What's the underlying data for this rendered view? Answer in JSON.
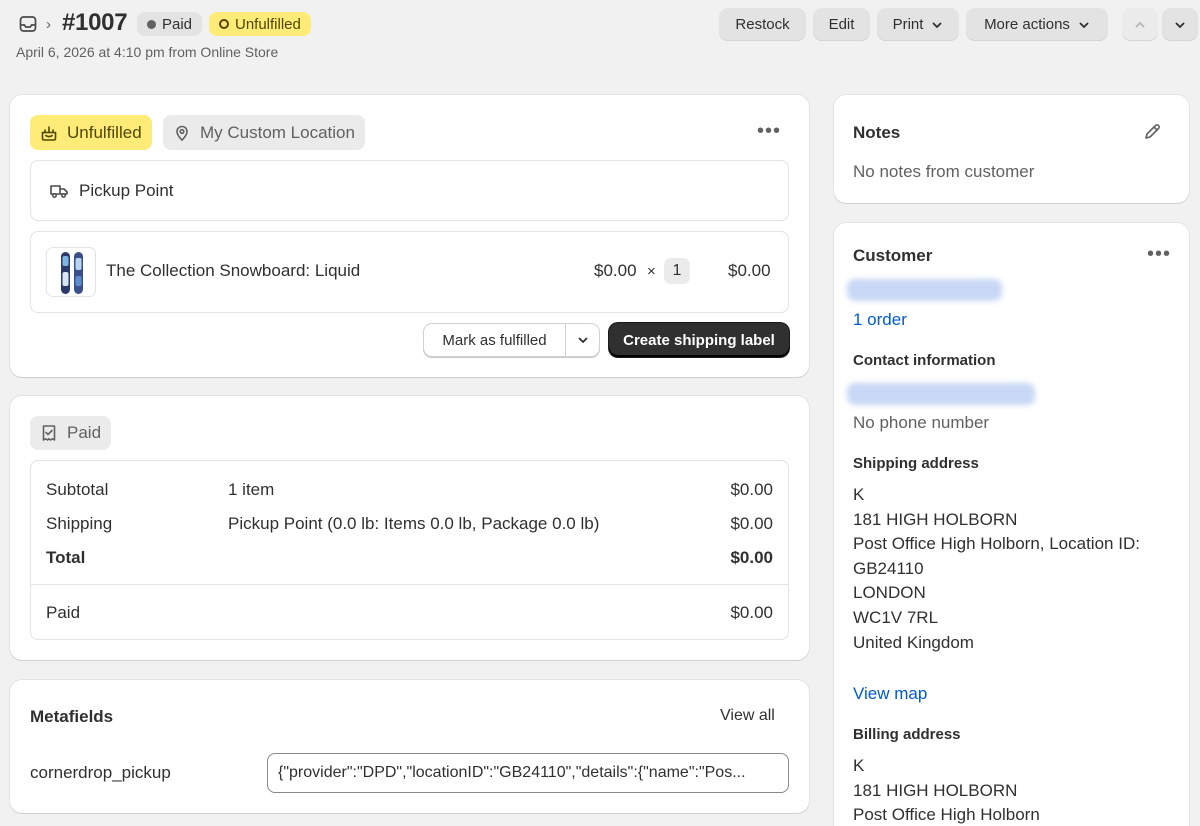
{
  "header": {
    "order_number": "#1007",
    "payment_status": "Paid",
    "fulfillment_status": "Unfulfilled",
    "subtitle": "April 6, 2026 at 4:10 pm from Online Store",
    "actions": {
      "restock": "Restock",
      "edit": "Edit",
      "print": "Print",
      "more": "More actions"
    }
  },
  "fulfillment_card": {
    "status": "Unfulfilled",
    "location": "My Custom Location",
    "delivery_method": "Pickup Point",
    "item": {
      "title": "The Collection Snowboard: Liquid",
      "price": "$0.00",
      "times": "×",
      "quantity": "1",
      "total": "$0.00"
    },
    "mark_fulfilled": "Mark as fulfilled",
    "create_label": "Create shipping label"
  },
  "payment_card": {
    "status": "Paid",
    "rows": [
      {
        "label": "Subtotal",
        "detail": "1 item",
        "amount": "$0.00"
      },
      {
        "label": "Shipping",
        "detail": "Pickup Point (0.0 lb: Items 0.0 lb, Package 0.0 lb)",
        "amount": "$0.00"
      },
      {
        "label": "Total",
        "detail": "",
        "amount": "$0.00"
      },
      {
        "label": "Paid",
        "detail": "",
        "amount": "$0.00"
      }
    ]
  },
  "metafields": {
    "title": "Metafields",
    "view_all": "View all",
    "key": "cornerdrop_pickup",
    "value": "{\"provider\":\"DPD\",\"locationID\":\"GB24110\",\"details\":{\"name\":\"Pos..."
  },
  "notes": {
    "title": "Notes",
    "text": "No notes from customer"
  },
  "customer": {
    "title": "Customer",
    "orders_link": "1 order",
    "contact_title": "Contact information",
    "phone": "No phone number",
    "shipping_title": "Shipping address",
    "shipping_lines": [
      "K",
      "181 HIGH HOLBORN",
      "Post Office High Holborn, Location ID:",
      "GB24110",
      "LONDON",
      "WC1V 7RL",
      "United Kingdom"
    ],
    "view_map": "View map",
    "billing_title": "Billing address",
    "billing_lines": [
      "K",
      "181 HIGH HOLBORN",
      "Post Office High Holborn"
    ]
  },
  "colors": {
    "unfulfilled_bg": "#ffeb78",
    "primary_button": "#303030",
    "link": "#005bd3"
  }
}
